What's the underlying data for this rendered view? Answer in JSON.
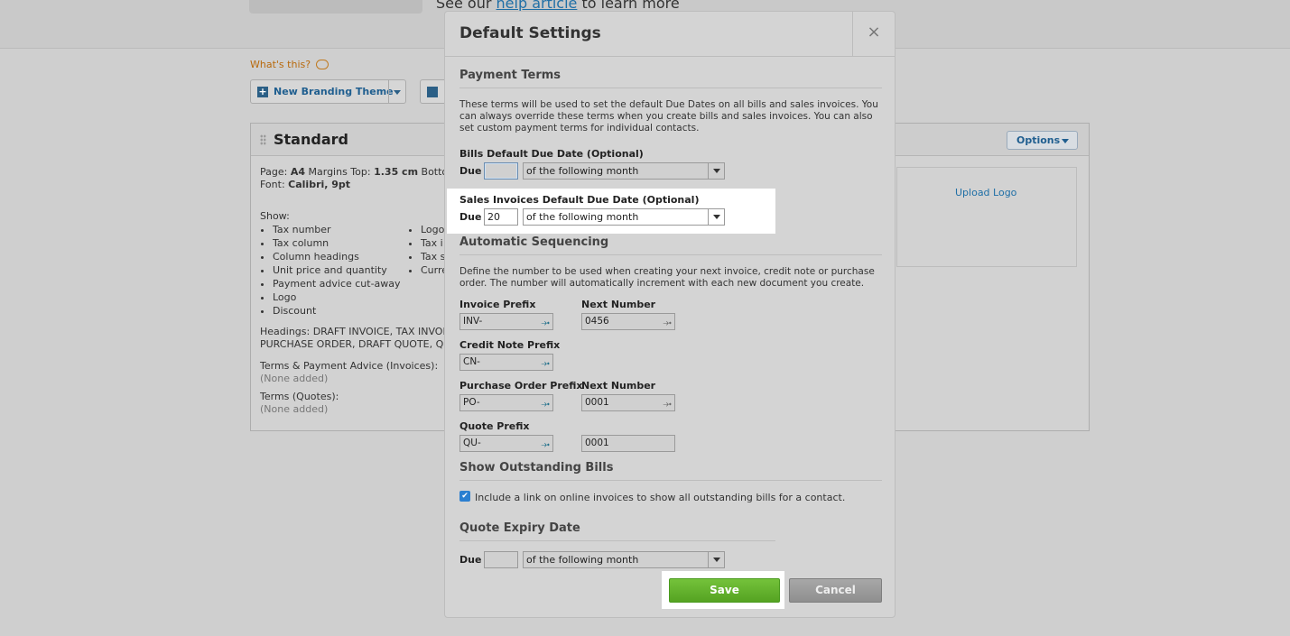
{
  "background": {
    "help_text_pre": "See our ",
    "help_link": "help article",
    "help_text_post": " to learn more",
    "whats_this": "What's this?",
    "new_branding_theme": "New Branding Theme",
    "theme": {
      "title": "Standard",
      "options": "Options",
      "page_line": [
        "Page: ",
        "A4",
        " Margins Top: ",
        "1.35 cm",
        " Bottom:"
      ],
      "font_line": [
        "Font: ",
        "Calibri, 9pt"
      ],
      "show_label": "Show:",
      "show_col1": [
        "Tax number",
        "Tax column",
        "Column headings",
        "Unit price and quantity",
        "Payment advice cut-away",
        "Logo",
        "Discount"
      ],
      "show_col2": [
        "Logo",
        "Tax i",
        "Tax s",
        "Curre"
      ],
      "headings_1": "Headings: DRAFT INVOICE, TAX INVOICE,",
      "headings_2": "PURCHASE ORDER, DRAFT QUOTE, QUOT",
      "terms_invoices": "Terms & Payment Advice (Invoices):",
      "terms_invoices_value": "(None added)",
      "terms_quotes": "Terms (Quotes):",
      "terms_quotes_value": "(None added)",
      "upload_logo": "Upload Logo"
    }
  },
  "modal": {
    "title": "Default Settings",
    "close": "×",
    "payment_terms": {
      "heading": "Payment Terms",
      "description": "These terms will be used to set the default Due Dates on all bills and sales invoices. You can always override these terms when you create bills and sales invoices. You can also set custom payment terms for individual contacts.",
      "bills_label": "Bills Default Due Date (Optional)",
      "bills_due_label": "Due",
      "bills_due_value": "",
      "bills_select": "of the following month",
      "sales_label": "Sales Invoices Default Due Date (Optional)",
      "sales_due_label": "Due",
      "sales_due_value": "20",
      "sales_select": "of the following month"
    },
    "sequencing": {
      "heading": "Automatic Sequencing",
      "description": "Define the number to be used when creating your next invoice, credit note or purchase order. The number will automatically increment with each new document you create.",
      "invoice_prefix_label": "Invoice Prefix",
      "invoice_prefix": "INV-",
      "invoice_next_label": "Next Number",
      "invoice_next": "0456",
      "credit_prefix_label": "Credit Note Prefix",
      "credit_prefix": "CN-",
      "po_prefix_label": "Purchase Order Prefix",
      "po_prefix": "PO-",
      "po_next_label": "Next Number",
      "po_next": "0001",
      "quote_prefix_label": "Quote Prefix",
      "quote_prefix": "QU-",
      "quote_next": "0001"
    },
    "outstanding": {
      "heading": "Show Outstanding Bills",
      "checkbox_label": "Include a link on online invoices to show all outstanding bills for a contact.",
      "checked": true
    },
    "quote_expiry": {
      "heading": "Quote Expiry Date",
      "due_label": "Due",
      "due_value": "",
      "select": "of the following month"
    },
    "save": "Save",
    "cancel": "Cancel"
  }
}
